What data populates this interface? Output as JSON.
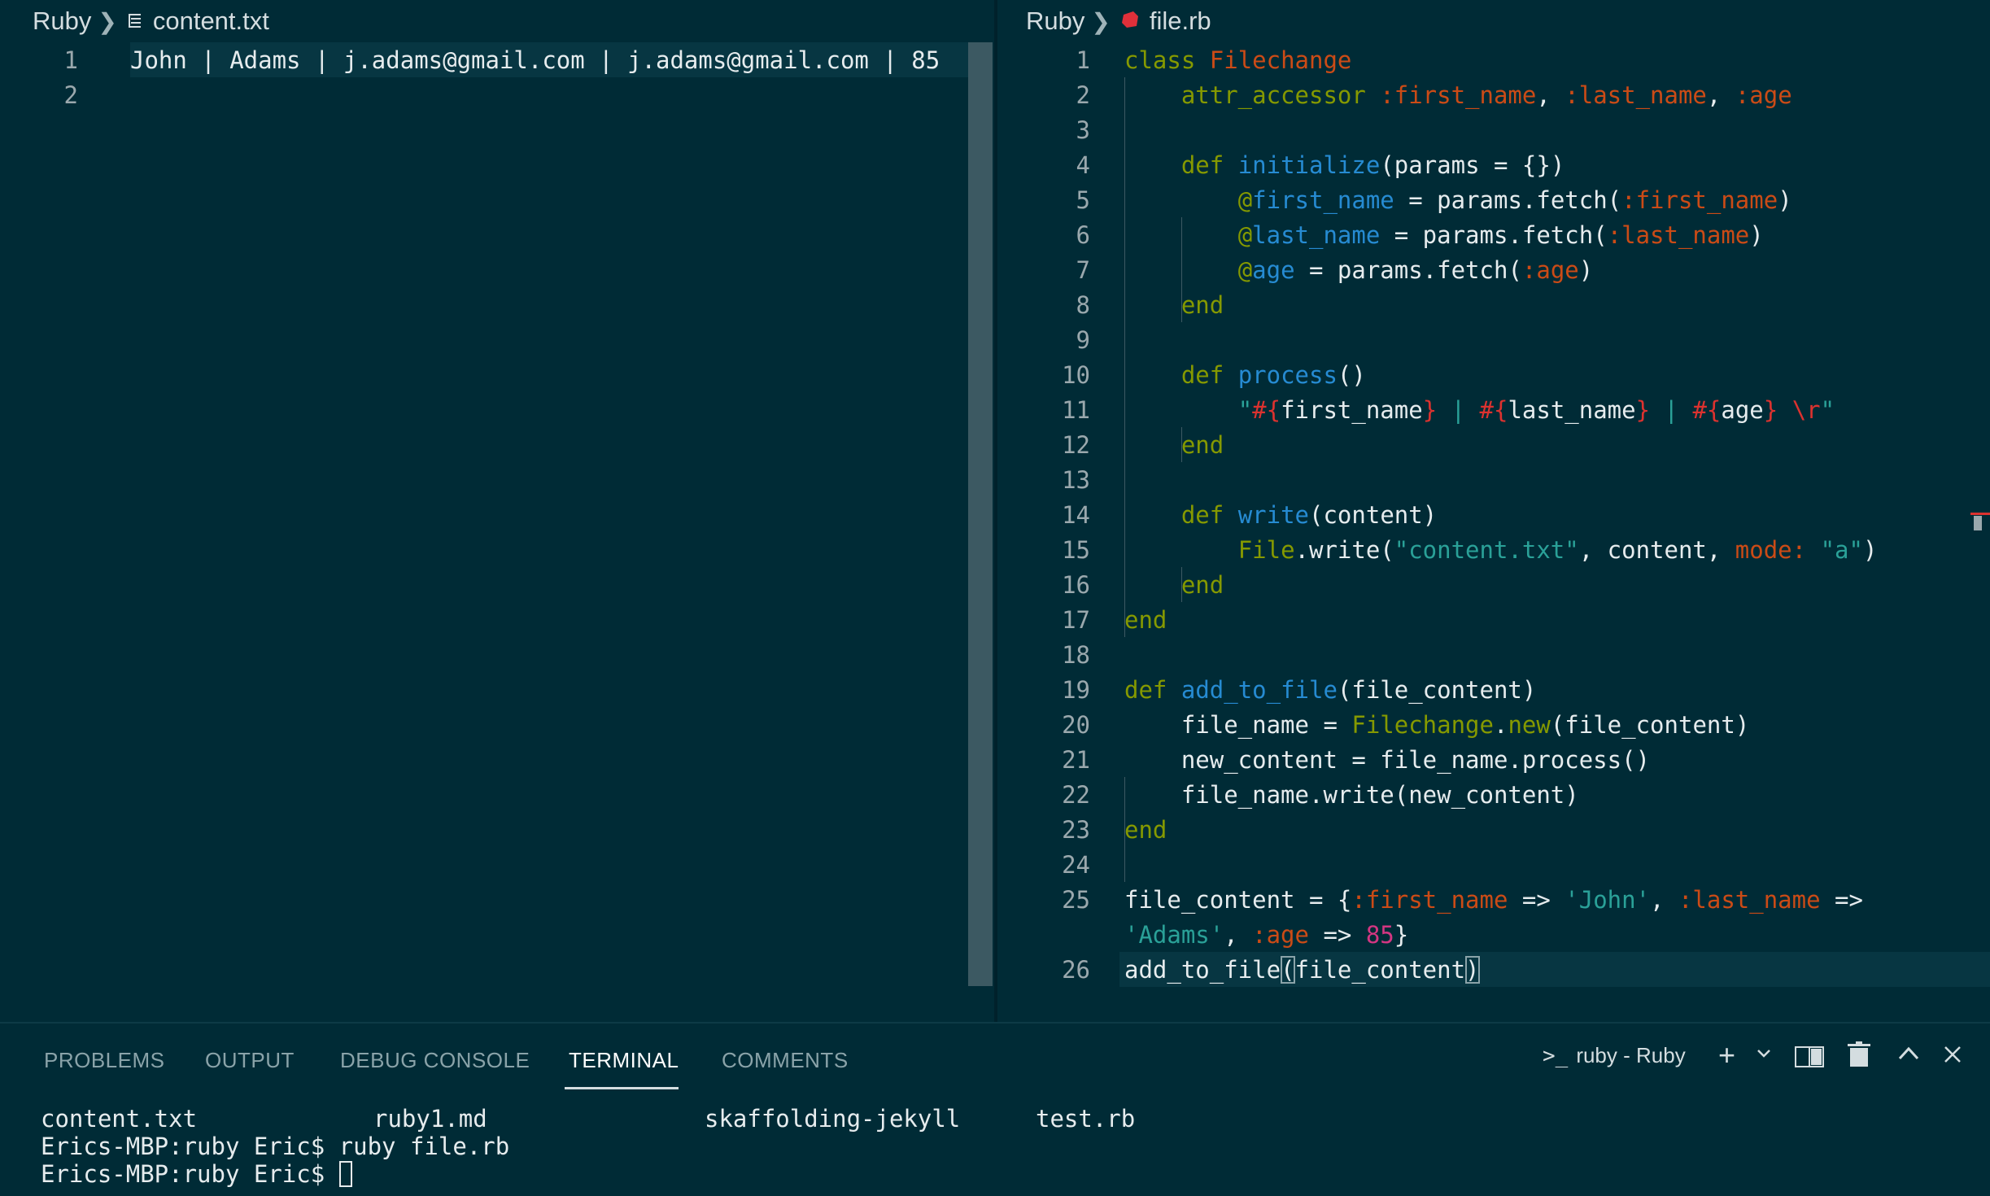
{
  "left_editor": {
    "breadcrumb": {
      "folder": "Ruby",
      "file": "content.txt"
    },
    "lines": [
      {
        "num": "1",
        "text": "John | Adams | j.adams@gmail.com | j.adams@gmail.com | 85"
      },
      {
        "num": "2",
        "text": ""
      }
    ]
  },
  "right_editor": {
    "breadcrumb": {
      "folder": "Ruby",
      "file": "file.rb"
    },
    "line_numbers": [
      "1",
      "2",
      "3",
      "4",
      "5",
      "6",
      "7",
      "8",
      "9",
      "10",
      "11",
      "12",
      "13",
      "14",
      "15",
      "16",
      "17",
      "18",
      "19",
      "20",
      "21",
      "22",
      "23",
      "24",
      "25",
      "",
      "26"
    ],
    "tokens": {
      "class_kw": "class",
      "class_name": "Filechange",
      "attr": "attr_accessor",
      "sym_first": ":first_name",
      "sym_last": ":last_name",
      "sym_age": ":age",
      "comma": ", ",
      "def": "def",
      "initialize": "initialize",
      "init_params": "(params = {})",
      "at": "@",
      "first_name": "first_name",
      "last_name": "last_name",
      "age": "age",
      "assign_fetch": " = params.fetch(",
      "close_paren": ")",
      "end": "end",
      "process": "process",
      "empty_parens": "()",
      "q_open": "\"",
      "hash_open": "#{",
      "brace_close": "}",
      "pipe": " | ",
      "r_esc": " \\r",
      "q_close": "\"",
      "write": "write",
      "content_arg": "(content)",
      "file_const": "File",
      "dot_write": ".write(",
      "str_content_txt": "\"content.txt\"",
      "content_comma": ", content, ",
      "mode": "mode:",
      "str_a": "\"a\"",
      "add_to_file": "add_to_file",
      "file_content_arg": "(file_content)",
      "file_name": "file_name",
      "eq": " = ",
      "filechange": "Filechange",
      "dot": ".",
      "new_kw": "new",
      "new_content_line": "new_content = file_name.process()",
      "write_call": "file_name.write(new_content)",
      "file_content_var": "file_content",
      "open_brace": "{",
      "arrow": " => ",
      "str_john": "'John'",
      "str_adams": "'Adams'",
      "num_85": "85",
      "close_brace": "}",
      "last_call": "add_to_file",
      "last_paren_open": "(",
      "last_arg": "file_content",
      "last_paren_close": ")"
    }
  },
  "panel": {
    "tabs": [
      "PROBLEMS",
      "OUTPUT",
      "DEBUG CONSOLE",
      "TERMINAL",
      "COMMENTS"
    ],
    "active_tab": "TERMINAL",
    "terminal_name": "ruby - Ruby",
    "terminal_lines": {
      "files": [
        "content.txt",
        "ruby1.md",
        "skaffolding-jekyll",
        "test.rb"
      ],
      "cmd1": "Erics-MBP:ruby Eric$ ruby file.rb",
      "prompt": "Erics-MBP:ruby Eric$ "
    }
  },
  "icons": [
    "file-text-icon",
    "ruby-file-icon",
    "terminal-icon",
    "plus-icon",
    "chevron-down-icon",
    "split-terminal-icon",
    "trash-icon",
    "chevron-up-icon",
    "close-icon"
  ],
  "colors": {
    "background": "#002b36",
    "keyword": "#859900",
    "symbol": "#cb4b16",
    "function": "#268bd2",
    "string": "#2aa198",
    "number": "#d33682"
  }
}
